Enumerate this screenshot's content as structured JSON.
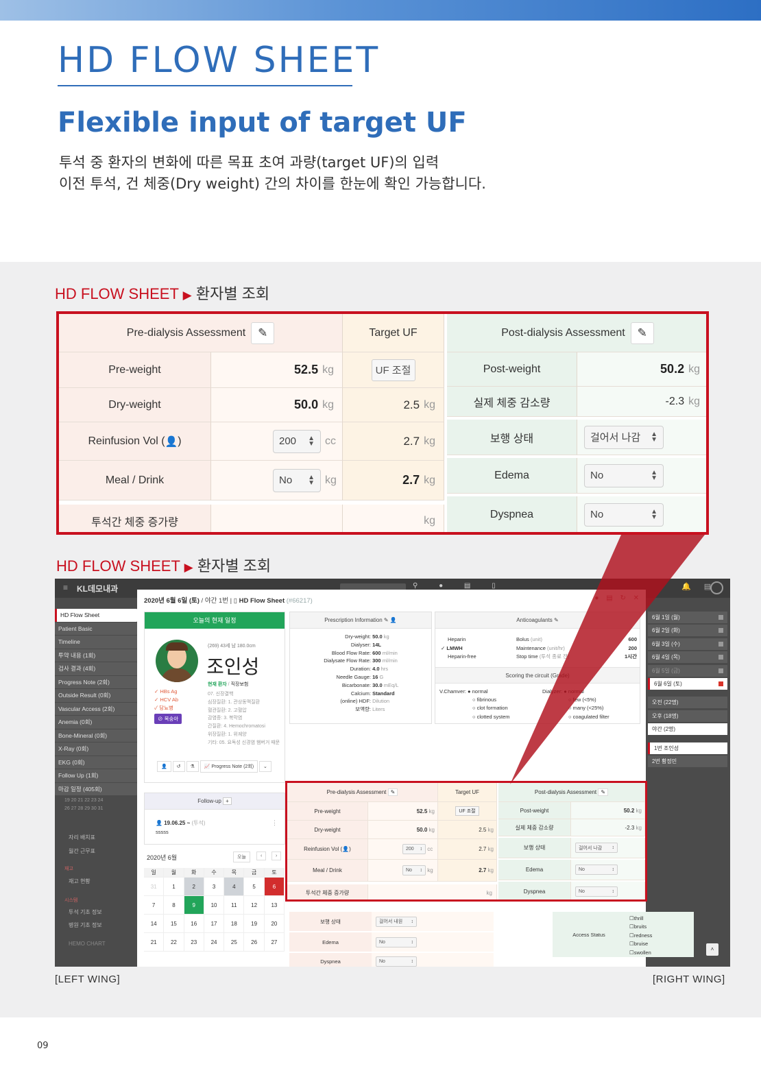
{
  "header": {
    "title": "HD FLOW SHEET",
    "subtitle": "Flexible input of target UF",
    "desc_line1": "투석 중 환자의 변화에 따른 목표 초여 과량(target UF)의 입력",
    "desc_line2": "이전 투석, 건 체중(Dry weight) 간의 차이를 한눈에 확인 가능합니다."
  },
  "section1": {
    "label": "HD FLOW SHEET",
    "arrow": "▶",
    "sub": "환자별 조회"
  },
  "section2": {
    "label": "HD FLOW SHEET",
    "arrow": "▶",
    "sub": "환자별 조회"
  },
  "zoom": {
    "pre_header": "Pre-dialysis Assessment",
    "target_header": "Target UF",
    "post_header": "Post-dialysis Assessment",
    "pre_rows": [
      {
        "label": "Pre-weight",
        "value": "52.5",
        "unit": "kg"
      },
      {
        "label": "Dry-weight",
        "value": "50.0",
        "unit": "kg"
      },
      {
        "label": "Reinfusion Vol (",
        "label_end": ")",
        "value": "200",
        "unit": "cc"
      },
      {
        "label": "Meal / Drink",
        "value": "No",
        "unit": "kg"
      },
      {
        "label": "투석간 체중 증가량",
        "value": "",
        "unit": "kg"
      }
    ],
    "target_rows": [
      {
        "button": "UF 조절"
      },
      {
        "value": "2.5",
        "unit": "kg"
      },
      {
        "value": "2.7",
        "unit": "kg"
      },
      {
        "value": "2.7",
        "unit": "kg"
      },
      {
        "value": "",
        "unit": "kg"
      }
    ],
    "post_rows": [
      {
        "label": "Post-weight",
        "value": "50.2",
        "unit": "kg"
      },
      {
        "label": "실제 체중 감소량",
        "value": "-2.3",
        "unit": "kg"
      },
      {
        "label": "보행 상태",
        "select": "걸어서 나감"
      },
      {
        "label": "Edema",
        "select": "No"
      },
      {
        "label": "Dyspnea",
        "select": "No"
      }
    ]
  },
  "screenshot": {
    "logo": "KL데모내과",
    "modal_date": "2020년 6월 6일 (토)",
    "modal_shift": "야간 1번",
    "modal_doc": "HD Flow Sheet",
    "modal_id": "(#66217)",
    "left_nav": [
      "HD Flow Sheet",
      "Patient Basic",
      "Timeline",
      "투약 내용 (1회)",
      "검사 결과 (4회)",
      "Progress Note (2회)",
      "Outside Result (0회)",
      "Vascular Access (2회)",
      "Anemia (0회)",
      "Bone-Mineral (0회)",
      "X-Ray (0회)",
      "EKG (0회)",
      "Follow Up (1회)",
      "마감 일정 (405회)"
    ],
    "left_lower": [
      "자리 배치표",
      "월간 근무표",
      "재고",
      "재고 현황",
      "시스템",
      "투석 기초 정보",
      "병원 기초 정보",
      "HEMO CHART"
    ],
    "right_nav": [
      {
        "label": "6월 1일 (월)",
        "mark": "gray",
        "light": false
      },
      {
        "label": "6월 2일 (화)",
        "mark": "gray",
        "light": false
      },
      {
        "label": "6월 3일 (수)",
        "mark": "gray",
        "light": false
      },
      {
        "label": "6월 4일 (목)",
        "mark": "gray",
        "light": false
      },
      {
        "label": "6월 5일 (금)",
        "mark": "gray",
        "light": false
      },
      {
        "label": "6월 6일 (토)",
        "mark": "red",
        "light": true
      },
      {
        "label": "오전 (22명)",
        "mark": "",
        "light": false
      },
      {
        "label": "오후 (18명)",
        "mark": "",
        "light": false
      },
      {
        "label": "야간 (2명)",
        "mark": "",
        "light": true
      },
      {
        "label": "1번 조인성",
        "mark": "",
        "light": true
      },
      {
        "label": "2번 황정민",
        "mark": "",
        "light": false
      }
    ],
    "patient": {
      "card_title": "오늘의 현재 일정",
      "meta": "(269) 43세 남 180.0cm",
      "name": "조인성",
      "status": "현재 환자",
      "insurance": "직장보험",
      "flags": [
        "HBs Ag",
        "HCV Ab",
        "당뇨병"
      ],
      "badge": "복숭아",
      "notes": [
        "07. 신장결핵",
        "심장질환: 1. 관상동맥질환",
        "혈관질환: 2. 고혈압",
        "감염증: 3. 복막염",
        "간질환: 4. Hemochromatosi",
        "위장질환: 1. 위궤양",
        "기타: 05. 요독성 신경염 햄버거 때문"
      ],
      "progress_btn": "Progress Note (2회)"
    },
    "prescription": {
      "title": "Prescription Information",
      "rows": [
        {
          "k": "Dry-weight:",
          "v": "50.0",
          "u": "kg"
        },
        {
          "k": "Dialyser:",
          "v": "14L",
          "u": ""
        },
        {
          "k": "Blood Flow Rate:",
          "v": "600",
          "u": "ml/min"
        },
        {
          "k": "Dialysate Flow Rate:",
          "v": "300",
          "u": "ml/min"
        },
        {
          "k": "Duration:",
          "v": "4.0",
          "u": "hrs"
        },
        {
          "k": "Needle Gauge:",
          "v": "16",
          "u": "G"
        },
        {
          "k": "Bicarbonate:",
          "v": "30.0",
          "u": "mEq/L"
        },
        {
          "k": "Calcium:",
          "v": "Standard",
          "u": ""
        },
        {
          "k": "(online) HDF:",
          "v": "",
          "u": "Dilution"
        },
        {
          "k": "보액량:",
          "v": "",
          "u": "Liters"
        }
      ]
    },
    "anticoag": {
      "title": "Anticoagulants",
      "left": [
        "Heparin",
        "LMWH",
        "Heparin-free"
      ],
      "right_k": [
        "Bolus",
        "Maintenance",
        "Stop time"
      ],
      "right_u": [
        "(unit)",
        "(unit/hr)",
        "(투석 종료 전)"
      ],
      "right_v": [
        "600",
        "200",
        "1시간"
      ],
      "scoring_title": "Scoring the circuit (Grade)",
      "v_chamver": "V.Chamver:",
      "dialyzer": "Dialyzer:",
      "v_opts": [
        "normal",
        "fibrinous",
        "clot formation",
        "clotted system"
      ],
      "d_opts": [
        "normal",
        "few (<5%)",
        "many (<25%)",
        "coagulated filter"
      ]
    },
    "followup": {
      "title": "Follow-up",
      "entry": "19.06.25 ~",
      "entry_tag": "(투석)",
      "entry_text": "sssss"
    },
    "calendar": {
      "title": "2020년 6월",
      "today": "오늘",
      "days": [
        "일",
        "월",
        "화",
        "수",
        "목",
        "금",
        "토"
      ],
      "weeks": [
        [
          "31",
          "1",
          "2",
          "3",
          "4",
          "5",
          "6"
        ],
        [
          "7",
          "8",
          "9",
          "10",
          "11",
          "12",
          "13"
        ],
        [
          "14",
          "15",
          "16",
          "17",
          "18",
          "19",
          "20"
        ],
        [
          "21",
          "22",
          "23",
          "24",
          "25",
          "26",
          "27"
        ]
      ],
      "prev_weeks": [
        "19 20 21 22 23 24",
        "26 27 28 29 30 31"
      ]
    },
    "mini": {
      "pre_header": "Pre-dialysis Assessment",
      "target_header": "Target UF",
      "post_header": "Post-dialysis Assessment",
      "pre_rows": [
        "Pre-weight",
        "Dry-weight",
        "Reinfusion Vol (",
        "Meal / Drink",
        "투석간 체중 증가량"
      ],
      "pre_vals": [
        "52.5",
        "50.0",
        "200",
        "No",
        ""
      ],
      "target_vals": [
        "UF 조절",
        "2.5",
        "2.7",
        "2.7",
        ""
      ],
      "post_rows": [
        "Post-weight",
        "실제 체중 감소량",
        "보행 상태",
        "Edema",
        "Dyspnea"
      ],
      "post_vals": [
        "50.2",
        "-2.3",
        "걸어서 나감",
        "No",
        "No"
      ],
      "below_rows": [
        "보행 상태",
        "Edema",
        "Dyspnea"
      ],
      "below_vals": [
        "걸어서 내원",
        "No",
        "No"
      ],
      "access_label": "Access Status",
      "access_opts": [
        "thrill",
        "bruits",
        "redness",
        "bruise",
        "swollen"
      ],
      "cc": "cc",
      "kg": "kg"
    }
  },
  "wings": {
    "left": "[LEFT WING]",
    "right": "[RIGHT WING]"
  },
  "page_number": "09",
  "colors": {
    "brand_blue": "#2f6db9",
    "accent_red": "#c8101f",
    "green": "#22a55a"
  }
}
